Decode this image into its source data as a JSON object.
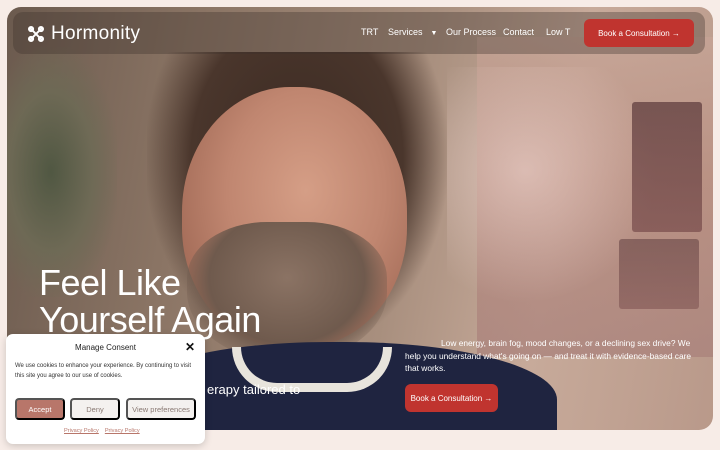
{
  "brand": {
    "name": "Hormonity"
  },
  "nav": {
    "links": [
      "TRT",
      "Services",
      "Our Process",
      "Contact",
      "Low T"
    ],
    "cta": "Book a Consultation →"
  },
  "hero": {
    "title_line1": "Feel Like",
    "title_line2": "Yourself Again",
    "subtitle_fragment": "erapy tailored to",
    "description": "Low energy, brain fog, mood changes, or a declining sex drive? We help you understand what's going on — and treat it with evidence-based care that works.",
    "cta": "Book a Consultation →"
  },
  "consent": {
    "title": "Manage Consent",
    "text": "We use cookies to enhance your experience. By continuing to visit this site you agree to our use of cookies.",
    "accept": "Accept",
    "deny": "Deny",
    "preferences": "View preferences",
    "links": [
      "Privacy Policy",
      "Privacy Policy"
    ]
  },
  "colors": {
    "accent": "#c0342f",
    "page_bg": "#f7ece7",
    "accept_btn": "#b8766a"
  },
  "icons": {
    "logo": "helix-cross-icon",
    "dropdown": "chevron-down-icon",
    "close": "close-icon"
  }
}
